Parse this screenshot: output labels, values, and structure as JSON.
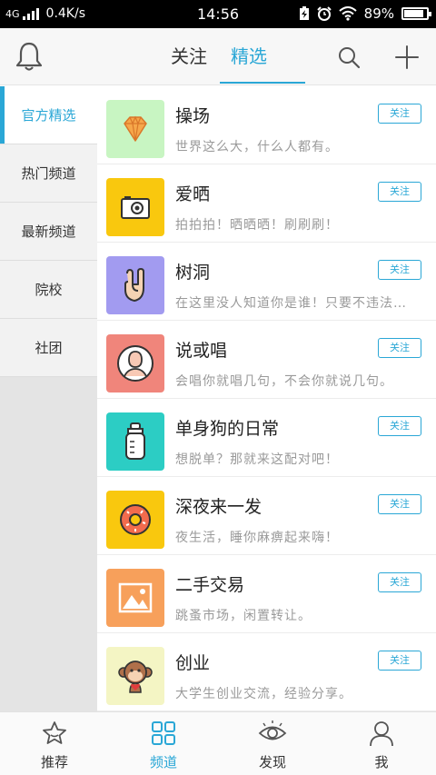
{
  "status_bar": {
    "network": "4G",
    "speed": "0.4K/s",
    "time": "14:56",
    "battery": "89%",
    "battery_level": 0.89
  },
  "header": {
    "tabs": [
      {
        "label": "关注",
        "active": false
      },
      {
        "label": "精选",
        "active": true
      }
    ]
  },
  "sidebar": {
    "items": [
      {
        "label": "官方精选",
        "active": true
      },
      {
        "label": "热门频道",
        "active": false
      },
      {
        "label": "最新频道",
        "active": false
      },
      {
        "label": "院校",
        "active": false
      },
      {
        "label": "社团",
        "active": false
      }
    ]
  },
  "channels": [
    {
      "title": "操场",
      "desc": "世界这么大，什么人都有。",
      "follow": "关注",
      "icon": "diamond-icon",
      "color": "#c8f5c2"
    },
    {
      "title": "爱晒",
      "desc": "拍拍拍！晒晒晒！刷刷刷！",
      "follow": "关注",
      "icon": "camera-icon",
      "color": "#f9c80e"
    },
    {
      "title": "树洞",
      "desc": "在这里没人知道你是谁！只要不违法…",
      "follow": "关注",
      "icon": "rock-hand-icon",
      "color": "#a29bf0"
    },
    {
      "title": "说或唱",
      "desc": "会唱你就唱几句，不会你就说几句。",
      "follow": "关注",
      "icon": "person-icon",
      "color": "#f0857b"
    },
    {
      "title": "单身狗的日常",
      "desc": "想脱单？那就来这配对吧！",
      "follow": "关注",
      "icon": "bottle-icon",
      "color": "#2ccdc4"
    },
    {
      "title": "深夜来一发",
      "desc": "夜生活，睡你麻痹起来嗨！",
      "follow": "关注",
      "icon": "donut-icon",
      "color": "#f9c80e"
    },
    {
      "title": "二手交易",
      "desc": "跳蚤市场，闲置转让。",
      "follow": "关注",
      "icon": "picture-icon",
      "color": "#f7a05b"
    },
    {
      "title": "创业",
      "desc": "大学生创业交流，经验分享。",
      "follow": "关注",
      "icon": "monkey-icon",
      "color": "#f4f5c4"
    }
  ],
  "bottom_nav": {
    "items": [
      {
        "label": "推荐",
        "icon": "star-icon",
        "active": false
      },
      {
        "label": "频道",
        "icon": "grid-icon",
        "active": true
      },
      {
        "label": "发现",
        "icon": "eye-icon",
        "active": false
      },
      {
        "label": "我",
        "icon": "user-icon",
        "active": false
      }
    ]
  },
  "colors": {
    "accent": "#2aa7d6",
    "sidebar_bg": "#f2f2f2"
  }
}
